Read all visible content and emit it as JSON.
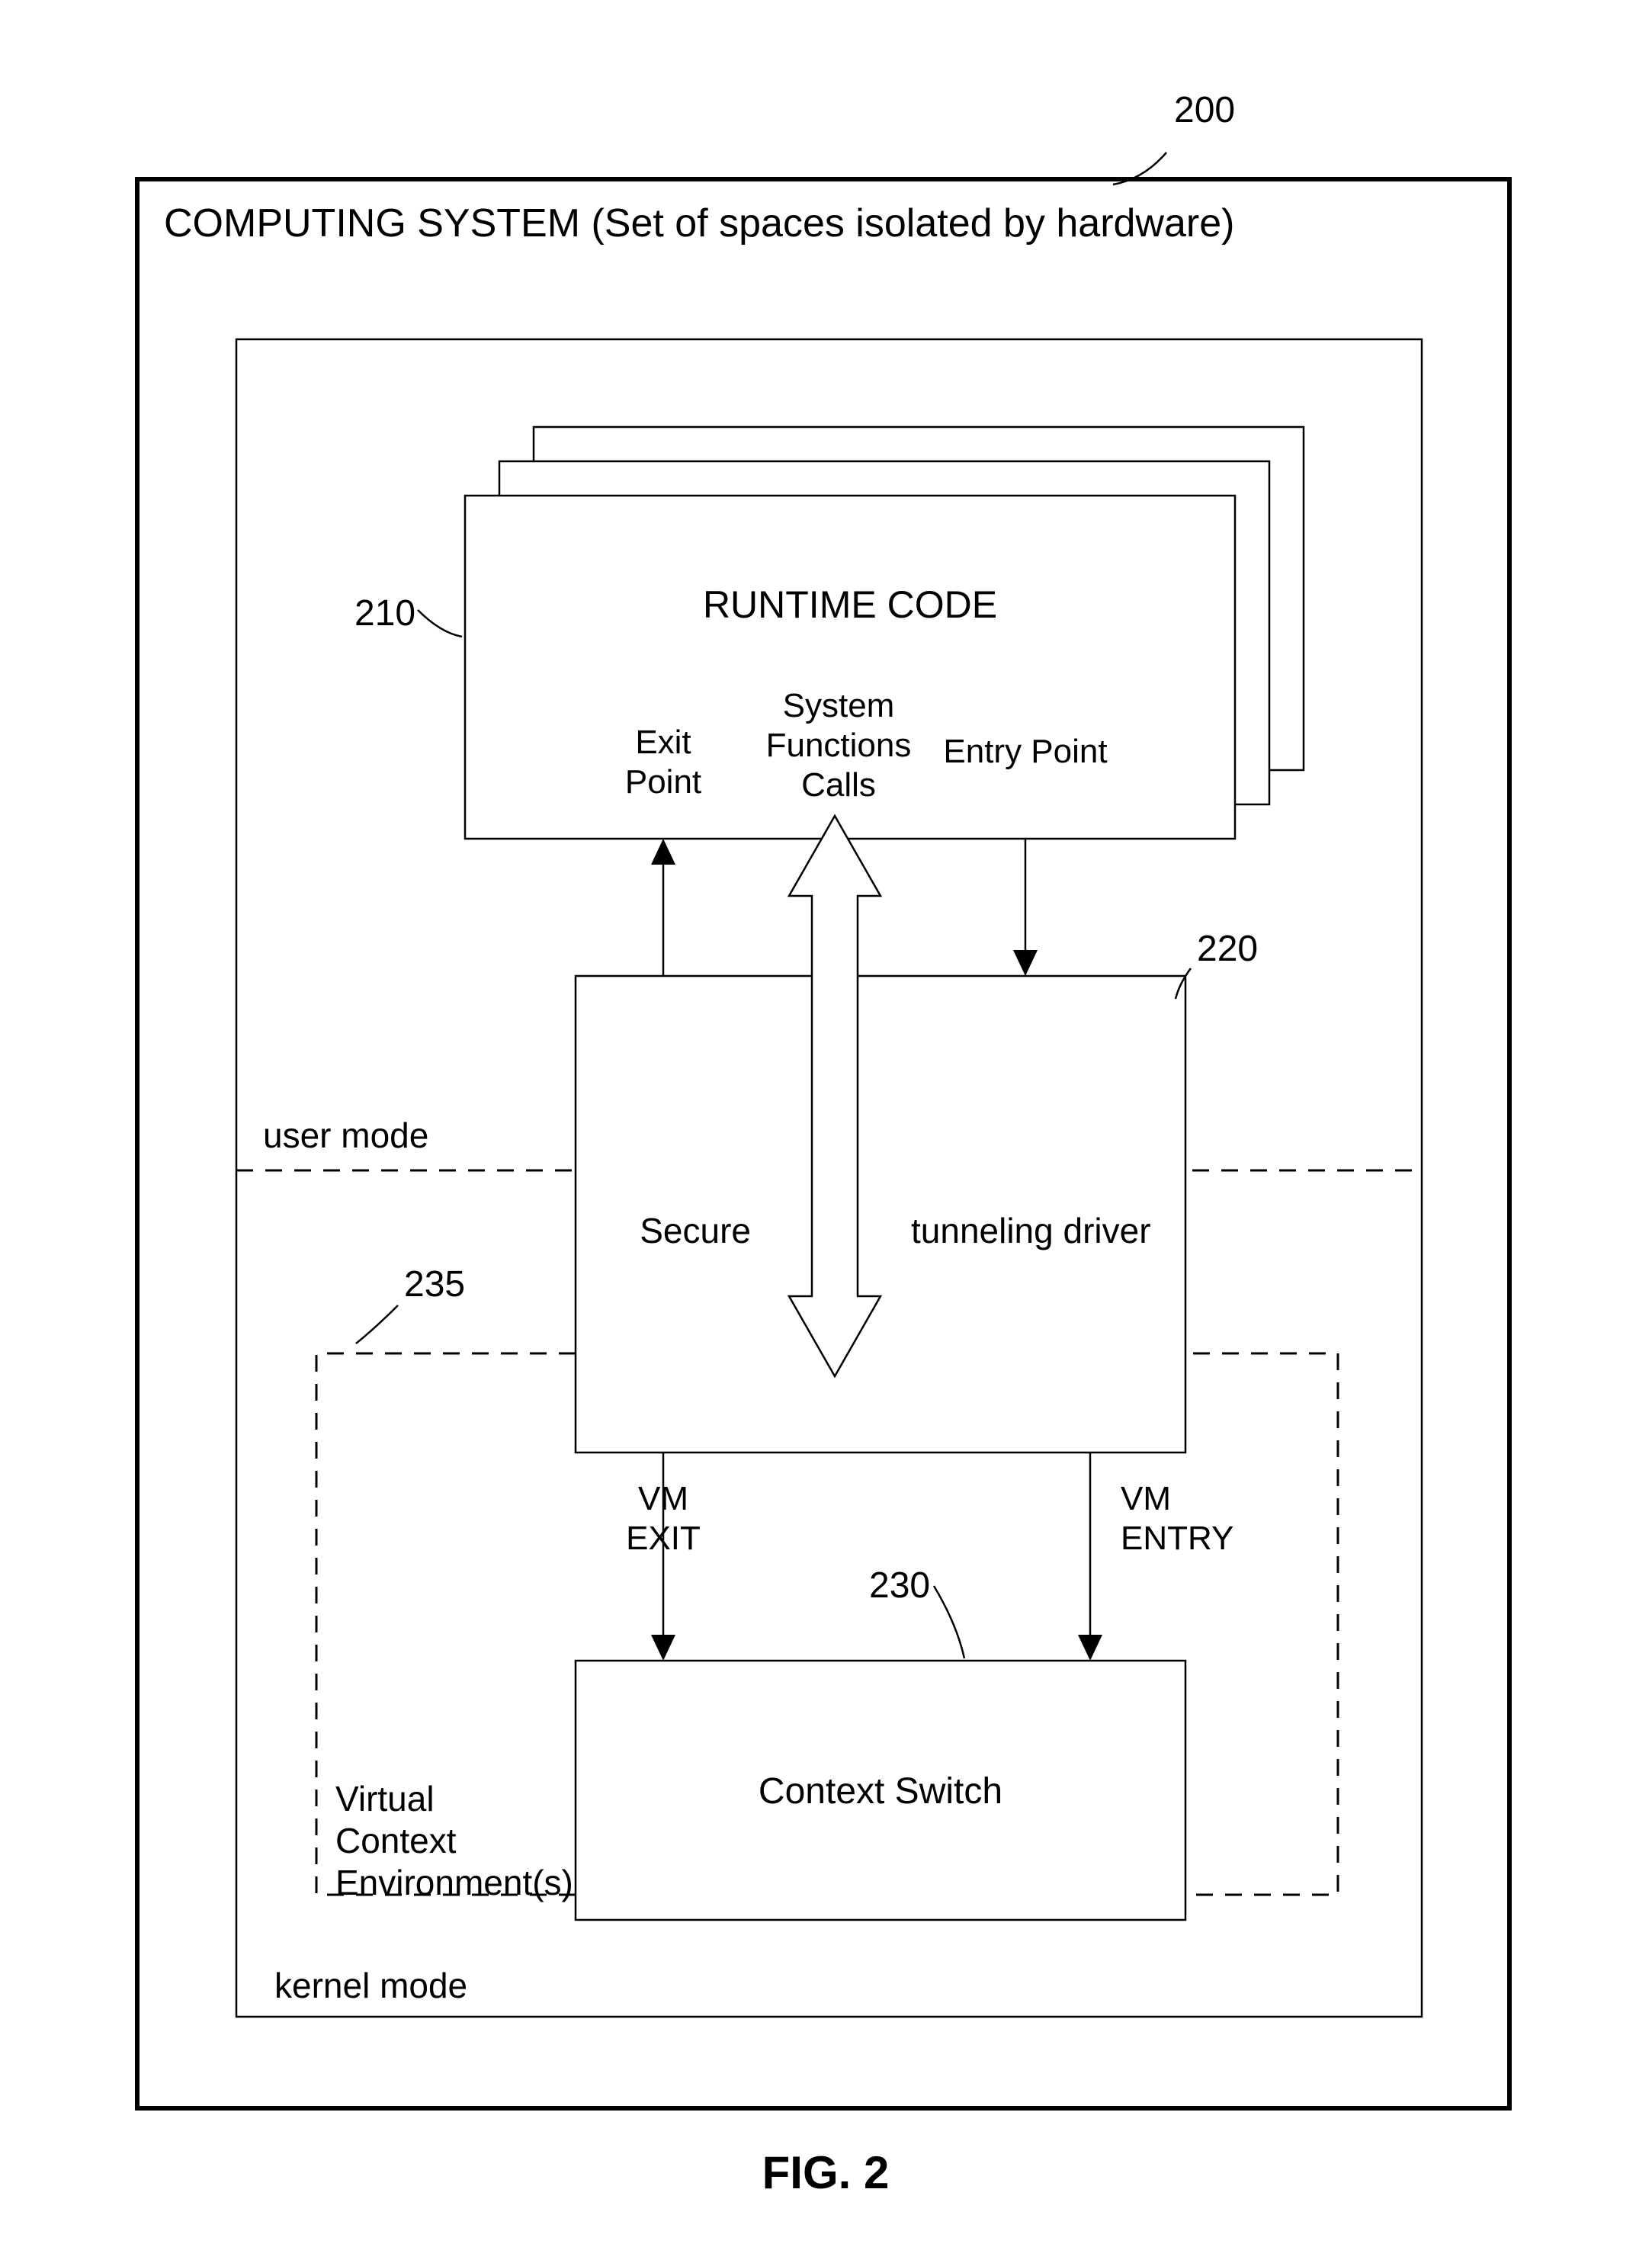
{
  "figure_label": "FIG. 2",
  "refs": {
    "system": "200",
    "runtime": "210",
    "driver": "220",
    "context": "230",
    "vce": "235"
  },
  "outer_title": "COMPUTING SYSTEM (Set of spaces isolated by hardware)",
  "runtime": {
    "title": "RUNTIME CODE",
    "exit": "Exit\nPoint",
    "calls": "System\nFunctions\nCalls",
    "entry": "Entry Point"
  },
  "modes": {
    "user": "user mode",
    "kernel": "kernel mode"
  },
  "driver": {
    "left": "Secure",
    "right": "tunneling driver"
  },
  "vm": {
    "exit": "VM\nEXIT",
    "entry": "VM\nENTRY"
  },
  "context_switch": "Context Switch",
  "vce_label": "Virtual\nContext\nEnvironment(s)"
}
